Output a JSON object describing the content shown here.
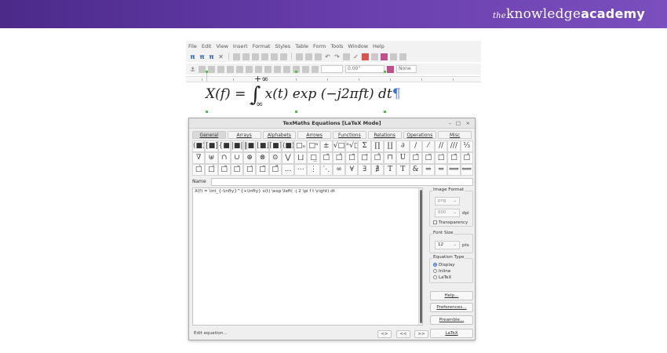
{
  "brand": {
    "the": "the",
    "main": "knowledge",
    "accent": "academy"
  },
  "menu": [
    "File",
    "Edit",
    "View",
    "Insert",
    "Format",
    "Styles",
    "Table",
    "Form",
    "Tools",
    "Window",
    "Help"
  ],
  "toolbar2": {
    "spacing_value": "0.00\"",
    "font_name": "None"
  },
  "formula": {
    "lhs": "X(f) =",
    "upper": "+∞",
    "lower": "−∞",
    "rhs": "x(t) exp (−j2πft) dt",
    "pilcrow": "¶"
  },
  "dialog": {
    "title": "TexMaths Equations [LaTeX Mode]",
    "window_buttons": [
      "–",
      "□",
      "×"
    ],
    "tabs": [
      "General",
      "Arrays",
      "Alphabets",
      "Arrows",
      "Functions",
      "Relations",
      "Operations",
      "Misc"
    ],
    "symbols_row1": [
      "(■)",
      "[■]",
      "{■}",
      "|■|",
      "‖■‖",
      "⌊■⌋",
      "⌈■⌉",
      "⟨■⟩",
      "□ₙ",
      "□ⁿ",
      "±",
      "√□",
      "ⁿ√□",
      "Σ",
      "∏",
      "∐",
      "∂",
      "/",
      "⁄",
      "//",
      "///",
      "⅓"
    ],
    "symbols_row2": [
      "∇",
      "⊎",
      "∩",
      "∪",
      "⊕",
      "⊗",
      "⊙",
      "⋁",
      "⨆",
      "□̲",
      "□̄",
      "□̂",
      "□̃",
      "□⃗",
      "□̂",
      "⊓",
      "Ȗ",
      "□̆",
      "□̈",
      "□̇",
      "□̃",
      "□̂"
    ],
    "symbols_row3": [
      "□̀",
      "□́",
      "□̄",
      "□̆",
      "□̇",
      "□̈",
      "□̊",
      "...",
      "⋯",
      "⋮",
      "⋱",
      "∞",
      "∀",
      "∃",
      "∄",
      "T",
      "T",
      "&",
      "⇔",
      "⇔",
      "⟺",
      "⟺"
    ],
    "name_label": "Name",
    "equation_text": "X(f) = \\int_{-\\infty}^{+\\infty} x(t) \\exp \\left( -j 2 \\pi f t \\right) dt",
    "image_format": {
      "label": "Image Format",
      "format": "png",
      "dpi_value": "600",
      "dpi_label": "dpi",
      "transparency": "Transparency"
    },
    "font_size": {
      "label": "Font Size",
      "value": "12",
      "unit": "pts"
    },
    "equation_type": {
      "label": "Equation Type",
      "options": [
        "Display",
        "Inline",
        "LaTeX"
      ],
      "selected": "Display"
    },
    "buttons": {
      "help": "Help...",
      "preferences": "Preferences...",
      "preamble": "Preamble...",
      "latex": "LaTeX"
    },
    "status": "Edit equation...",
    "nav": [
      "<>",
      "<<",
      ">>"
    ]
  }
}
